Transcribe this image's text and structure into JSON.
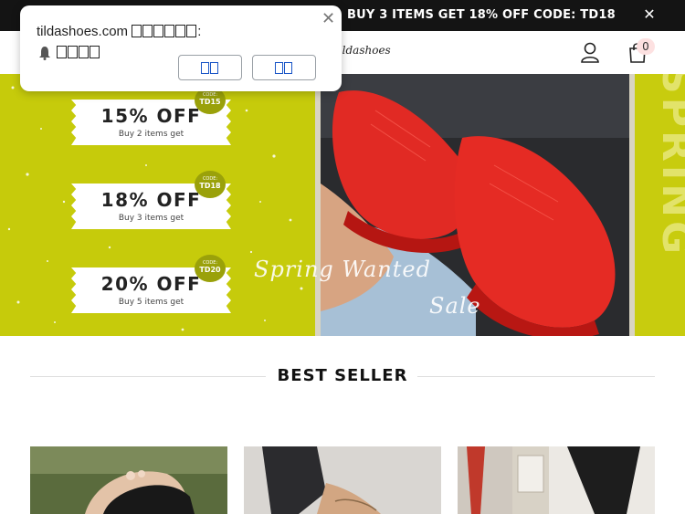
{
  "announcement": {
    "text": "BUY 3 ITEMS GET 18% OFF CODE: TD18",
    "close_icon": "close-icon"
  },
  "header": {
    "logo_text": "tildashoes",
    "account_icon": "user-icon",
    "cart_icon": "shopping-bag-icon",
    "cart_count": "0"
  },
  "hero": {
    "coupons": [
      {
        "title": "15% OFF",
        "subtitle": "Buy 2 items get",
        "badge_label": "CODE:",
        "badge_code": "TD15"
      },
      {
        "title": "18% OFF",
        "subtitle": "Buy 3 items get",
        "badge_label": "CODE:",
        "badge_code": "TD18"
      },
      {
        "title": "20% OFF",
        "subtitle": "Buy 5 items get",
        "badge_label": "CODE:",
        "badge_code": "TD20"
      }
    ],
    "script_line1": "Spring Wanted",
    "script_line2": "Sale",
    "side_text": "SPRING",
    "accent_color": "#c6cb0b"
  },
  "section": {
    "title": "BEST SELLER"
  },
  "notification": {
    "site": "tildashoes.com",
    "title_suffix": ":",
    "title_glyph_count": 6,
    "message_glyph_count": 4,
    "allow_glyph_count": 2,
    "block_glyph_count": 2,
    "bell_icon": "bell-icon",
    "close_icon": "close-icon"
  }
}
